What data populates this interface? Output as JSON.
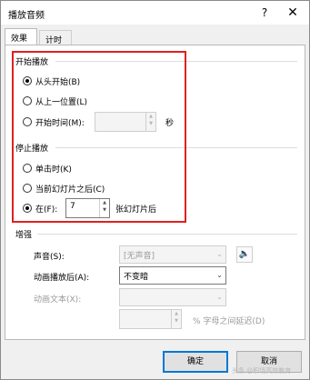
{
  "window": {
    "title": "播放音频",
    "help_glyph": "?",
    "close_glyph": "✕"
  },
  "tabs": [
    {
      "label": "效果",
      "active": true
    },
    {
      "label": "计时",
      "active": false
    }
  ],
  "start_section": {
    "title": "开始播放",
    "options": [
      {
        "label": "从头开始(B)",
        "checked": true
      },
      {
        "label": "从上一位置(L)",
        "checked": false
      },
      {
        "label": "开始时间(M):",
        "checked": false
      }
    ],
    "start_time_value": "",
    "start_time_unit": "秒"
  },
  "stop_section": {
    "title": "停止播放",
    "options": [
      {
        "label": "单击时(K)",
        "checked": false
      },
      {
        "label": "当前幻灯片之后(C)",
        "checked": false
      },
      {
        "label": "在(F):",
        "checked": true
      }
    ],
    "after_value": "7",
    "after_unit": "张幻灯片后"
  },
  "enhance_section": {
    "title": "增强",
    "sound_label": "声音(S):",
    "sound_value": "[无声音]",
    "after_anim_label": "动画播放后(A):",
    "after_anim_value": "不变暗",
    "anim_text_label": "动画文本(X):",
    "anim_text_value": "",
    "delay_value": "",
    "delay_label": "% 字母之间延迟(D)"
  },
  "footer": {
    "ok_label": "确定",
    "cancel_label": "取消"
  },
  "watermark": "头条 @职场高效教育"
}
